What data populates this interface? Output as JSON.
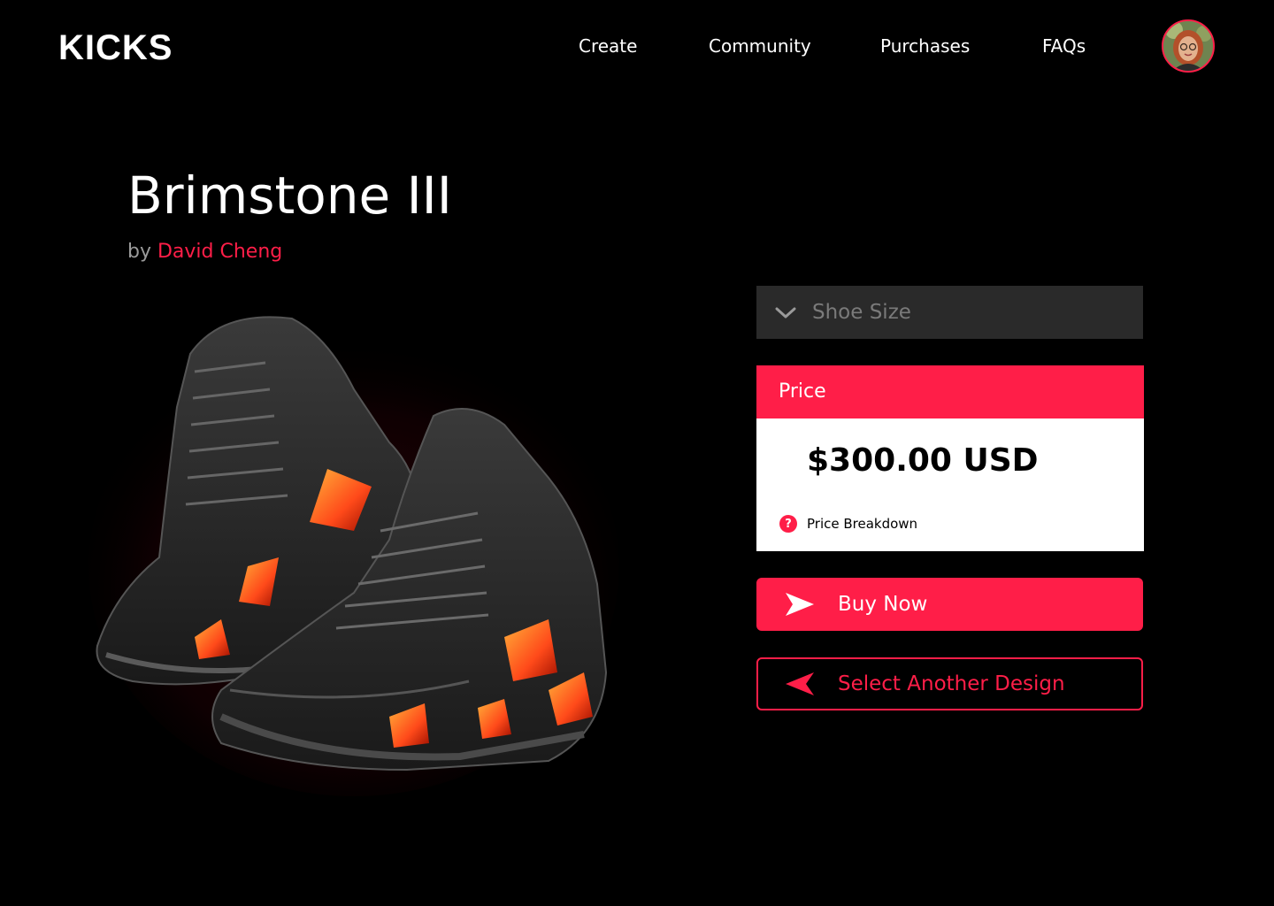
{
  "header": {
    "logo": "KICKS",
    "nav": [
      "Create",
      "Community",
      "Purchases",
      "FAQs"
    ]
  },
  "product": {
    "title": "Brimstone III",
    "by_prefix": "by",
    "author": "David Cheng"
  },
  "size_select": {
    "placeholder": "Shoe Size"
  },
  "price": {
    "heading": "Price",
    "amount": "$300.00 USD",
    "breakdown_label": "Price Breakdown"
  },
  "actions": {
    "buy_label": "Buy Now",
    "alt_label": "Select Another Design"
  },
  "colors": {
    "accent": "#ff1e48",
    "background": "#000000",
    "select_bg": "#2a2a2a"
  },
  "icons": {
    "size_select": "chevron-down-icon",
    "breakdown": "question-icon",
    "buy": "send-arrow-icon",
    "alt": "back-arrow-icon"
  }
}
